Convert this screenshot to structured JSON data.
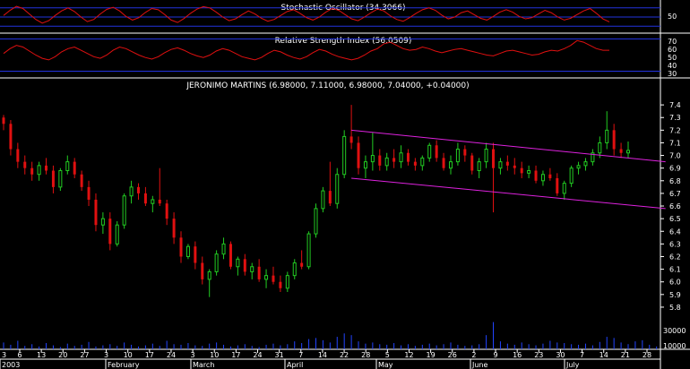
{
  "panels": {
    "stochastic": {
      "title": "Stochastic Oscillator (34.3066)",
      "ticks": [
        "50"
      ],
      "range": [
        0,
        100
      ],
      "bands": [
        20,
        50,
        80
      ],
      "values": [
        55,
        72,
        85,
        78,
        60,
        42,
        30,
        38,
        55,
        70,
        80,
        68,
        50,
        35,
        42,
        60,
        75,
        82,
        70,
        52,
        40,
        48,
        65,
        78,
        74,
        58,
        40,
        32,
        45,
        62,
        76,
        84,
        80,
        66,
        50,
        38,
        44,
        58,
        70,
        60,
        46,
        36,
        42,
        55,
        68,
        74,
        62,
        48,
        40,
        50,
        66,
        78,
        72,
        58,
        44,
        38,
        50,
        64,
        76,
        70,
        54,
        42,
        36,
        48,
        62,
        74,
        80,
        72,
        56,
        44,
        50,
        64,
        70,
        58,
        46,
        40,
        52,
        66,
        74,
        66,
        52,
        44,
        48,
        60,
        72,
        64,
        50,
        40,
        46,
        58,
        70,
        78,
        62,
        44,
        34
      ]
    },
    "rsi": {
      "title": "Relative Strength Index (56.0509)",
      "ticks": [
        "70",
        "60",
        "50",
        "40",
        "30"
      ],
      "range": [
        25,
        75
      ],
      "bands": [
        30,
        70
      ],
      "values": [
        52,
        58,
        62,
        60,
        55,
        50,
        46,
        44,
        48,
        54,
        58,
        60,
        56,
        52,
        48,
        46,
        50,
        56,
        60,
        58,
        54,
        50,
        47,
        45,
        48,
        53,
        57,
        59,
        56,
        52,
        49,
        47,
        50,
        55,
        58,
        56,
        52,
        48,
        46,
        44,
        47,
        52,
        56,
        54,
        50,
        47,
        45,
        48,
        53,
        57,
        55,
        51,
        48,
        46,
        44,
        46,
        50,
        55,
        58,
        64,
        66,
        62,
        58,
        56,
        57,
        60,
        58,
        55,
        53,
        55,
        57,
        58,
        56,
        54,
        52,
        50,
        49,
        52,
        55,
        56,
        54,
        52,
        50,
        51,
        54,
        56,
        55,
        58,
        62,
        68,
        66,
        62,
        58,
        56,
        56
      ]
    },
    "price": {
      "title": "JERONIMO MARTINS (6.98000, 7.11000, 6.98000, 7.04000, +0.04000)",
      "ticks": [
        "7.4",
        "7.3",
        "7.2",
        "7.1",
        "7.0",
        "6.9",
        "6.8",
        "6.7",
        "6.6",
        "6.5",
        "6.4",
        "6.3",
        "6.2",
        "6.1",
        "6.0",
        "5.9",
        "5.8"
      ],
      "range": [
        5.75,
        7.5
      ]
    },
    "volume": {
      "ticks": [
        "30000",
        "10000"
      ],
      "range": [
        0,
        60000
      ]
    }
  },
  "chart_data": {
    "type": "candlestick",
    "title": "JERONIMO MARTINS (6.98000, 7.11000, 6.98000, 7.04000, +0.04000)",
    "ylim": [
      5.75,
      7.5
    ],
    "ohlc": [
      [
        7.3,
        7.32,
        7.2,
        7.25
      ],
      [
        7.25,
        7.28,
        7.0,
        7.05
      ],
      [
        7.05,
        7.1,
        6.9,
        6.95
      ],
      [
        6.95,
        7.0,
        6.85,
        6.9
      ],
      [
        6.9,
        6.95,
        6.8,
        6.85
      ],
      [
        6.85,
        6.95,
        6.8,
        6.92
      ],
      [
        6.92,
        6.98,
        6.85,
        6.88
      ],
      [
        6.88,
        6.92,
        6.7,
        6.75
      ],
      [
        6.75,
        6.9,
        6.72,
        6.88
      ],
      [
        6.88,
        7.0,
        6.85,
        6.95
      ],
      [
        6.95,
        6.98,
        6.82,
        6.85
      ],
      [
        6.85,
        6.88,
        6.72,
        6.75
      ],
      [
        6.75,
        6.8,
        6.6,
        6.65
      ],
      [
        6.65,
        6.7,
        6.4,
        6.45
      ],
      [
        6.45,
        6.55,
        6.38,
        6.5
      ],
      [
        6.5,
        6.55,
        6.25,
        6.3
      ],
      [
        6.3,
        6.48,
        6.28,
        6.45
      ],
      [
        6.45,
        6.7,
        6.42,
        6.68
      ],
      [
        6.68,
        6.8,
        6.62,
        6.75
      ],
      [
        6.75,
        6.78,
        6.65,
        6.7
      ],
      [
        6.7,
        6.75,
        6.6,
        6.62
      ],
      [
        6.62,
        6.68,
        6.55,
        6.65
      ],
      [
        6.65,
        6.9,
        6.6,
        6.62
      ],
      [
        6.62,
        6.65,
        6.45,
        6.5
      ],
      [
        6.5,
        6.55,
        6.3,
        6.35
      ],
      [
        6.35,
        6.4,
        6.15,
        6.2
      ],
      [
        6.2,
        6.3,
        6.18,
        6.28
      ],
      [
        6.28,
        6.32,
        6.1,
        6.15
      ],
      [
        6.15,
        6.2,
        5.98,
        6.02
      ],
      [
        6.02,
        6.1,
        5.88,
        6.08
      ],
      [
        6.08,
        6.25,
        6.05,
        6.22
      ],
      [
        6.22,
        6.35,
        6.18,
        6.3
      ],
      [
        6.3,
        6.32,
        6.1,
        6.12
      ],
      [
        6.12,
        6.2,
        6.05,
        6.18
      ],
      [
        6.18,
        6.22,
        6.05,
        6.08
      ],
      [
        6.08,
        6.15,
        6.02,
        6.12
      ],
      [
        6.12,
        6.18,
        6.0,
        6.02
      ],
      [
        6.02,
        6.1,
        5.95,
        6.05
      ],
      [
        6.05,
        6.12,
        5.98,
        6.0
      ],
      [
        6.0,
        6.05,
        5.92,
        5.95
      ],
      [
        5.95,
        6.08,
        5.92,
        6.05
      ],
      [
        6.05,
        6.18,
        6.02,
        6.15
      ],
      [
        6.15,
        6.25,
        6.1,
        6.12
      ],
      [
        6.12,
        6.4,
        6.1,
        6.38
      ],
      [
        6.38,
        6.62,
        6.35,
        6.58
      ],
      [
        6.58,
        6.75,
        6.55,
        6.72
      ],
      [
        6.72,
        6.95,
        6.6,
        6.62
      ],
      [
        6.62,
        6.9,
        6.58,
        6.85
      ],
      [
        6.85,
        7.2,
        6.82,
        7.15
      ],
      [
        7.15,
        7.4,
        7.05,
        7.1
      ],
      [
        7.1,
        7.15,
        6.85,
        6.9
      ],
      [
        6.9,
        7.0,
        6.82,
        6.95
      ],
      [
        6.95,
        7.18,
        6.88,
        7.0
      ],
      [
        7.0,
        7.05,
        6.88,
        6.92
      ],
      [
        6.92,
        7.02,
        6.88,
        6.98
      ],
      [
        6.98,
        7.05,
        6.9,
        6.95
      ],
      [
        6.95,
        7.08,
        6.9,
        7.02
      ],
      [
        7.02,
        7.05,
        6.92,
        6.95
      ],
      [
        6.95,
        6.98,
        6.88,
        6.92
      ],
      [
        6.92,
        7.0,
        6.88,
        6.98
      ],
      [
        6.98,
        7.1,
        6.95,
        7.08
      ],
      [
        7.08,
        7.12,
        6.95,
        6.98
      ],
      [
        6.98,
        7.02,
        6.88,
        6.9
      ],
      [
        6.9,
        7.0,
        6.85,
        6.95
      ],
      [
        6.95,
        7.1,
        6.92,
        7.05
      ],
      [
        7.05,
        7.08,
        6.95,
        7.0
      ],
      [
        7.0,
        7.02,
        6.85,
        6.88
      ],
      [
        6.88,
        6.98,
        6.82,
        6.95
      ],
      [
        6.95,
        7.1,
        6.9,
        7.05
      ],
      [
        7.05,
        7.1,
        6.55,
        6.9
      ],
      [
        6.9,
        6.98,
        6.85,
        6.95
      ],
      [
        6.95,
        7.0,
        6.88,
        6.92
      ],
      [
        6.92,
        6.98,
        6.85,
        6.9
      ],
      [
        6.9,
        6.95,
        6.82,
        6.86
      ],
      [
        6.86,
        6.92,
        6.82,
        6.88
      ],
      [
        6.88,
        6.92,
        6.78,
        6.8
      ],
      [
        6.8,
        6.88,
        6.76,
        6.85
      ],
      [
        6.85,
        6.9,
        6.8,
        6.82
      ],
      [
        6.82,
        6.86,
        6.68,
        6.7
      ],
      [
        6.7,
        6.8,
        6.65,
        6.78
      ],
      [
        6.78,
        6.92,
        6.75,
        6.9
      ],
      [
        6.9,
        6.95,
        6.85,
        6.92
      ],
      [
        6.92,
        6.98,
        6.88,
        6.95
      ],
      [
        6.95,
        7.05,
        6.92,
        7.02
      ],
      [
        7.02,
        7.15,
        6.98,
        7.1
      ],
      [
        7.1,
        7.35,
        7.05,
        7.2
      ],
      [
        7.2,
        7.25,
        7.0,
        7.05
      ],
      [
        7.05,
        7.1,
        6.98,
        7.02
      ],
      [
        7.02,
        7.11,
        6.98,
        7.04
      ]
    ],
    "volume": [
      12000,
      8000,
      15000,
      6000,
      9000,
      5000,
      11000,
      7000,
      4000,
      10000,
      6000,
      8000,
      13000,
      5000,
      7000,
      9000,
      6000,
      12000,
      8000,
      5000,
      7000,
      10000,
      6000,
      15000,
      9000,
      8000,
      11000,
      7000,
      6000,
      10000,
      12000,
      8000,
      5000,
      7000,
      9000,
      6000,
      4000,
      8000,
      10000,
      7000,
      9000,
      14000,
      11000,
      18000,
      20000,
      16000,
      12000,
      22000,
      28000,
      25000,
      14000,
      10000,
      12000,
      9000,
      8000,
      11000,
      7000,
      9000,
      6000,
      8000,
      10000,
      7000,
      9000,
      12000,
      8000,
      6000,
      7000,
      9000,
      25000,
      48000,
      14000,
      10000,
      8000,
      12000,
      9000,
      7000,
      10000,
      15000,
      12000,
      11000,
      9000,
      8000,
      10000,
      7000,
      13000,
      22000,
      20000,
      12000,
      9000,
      14000,
      16000,
      8000,
      5000
    ],
    "channel": {
      "upper": {
        "from": [
          49,
          7.2
        ],
        "to": [
          92,
          6.95
        ]
      },
      "lower": {
        "from": [
          49,
          6.82
        ],
        "to": [
          92,
          6.58
        ]
      }
    }
  },
  "x_axis": {
    "day_labels": [
      "6",
      "13",
      "20",
      "27",
      "3",
      "10",
      "17",
      "24",
      "3",
      "10",
      "17",
      "24",
      "31",
      "7",
      "14",
      "22",
      "28",
      "5",
      "12",
      "19",
      "26",
      "2",
      "9",
      "16",
      "23",
      "30",
      "7",
      "14",
      "21",
      "28"
    ],
    "month_labels": [
      "2003",
      "February",
      "March",
      "April",
      "May",
      "June",
      "July"
    ],
    "first_day_label": "3"
  },
  "colors": {
    "background": "#000000",
    "up": "#22cc22",
    "down": "#e01010",
    "indicator_line": "#e01010",
    "band": "#2233dd",
    "channel": "#dd22dd",
    "axis": "#ffffff",
    "grid_separator": "#ffffff"
  }
}
